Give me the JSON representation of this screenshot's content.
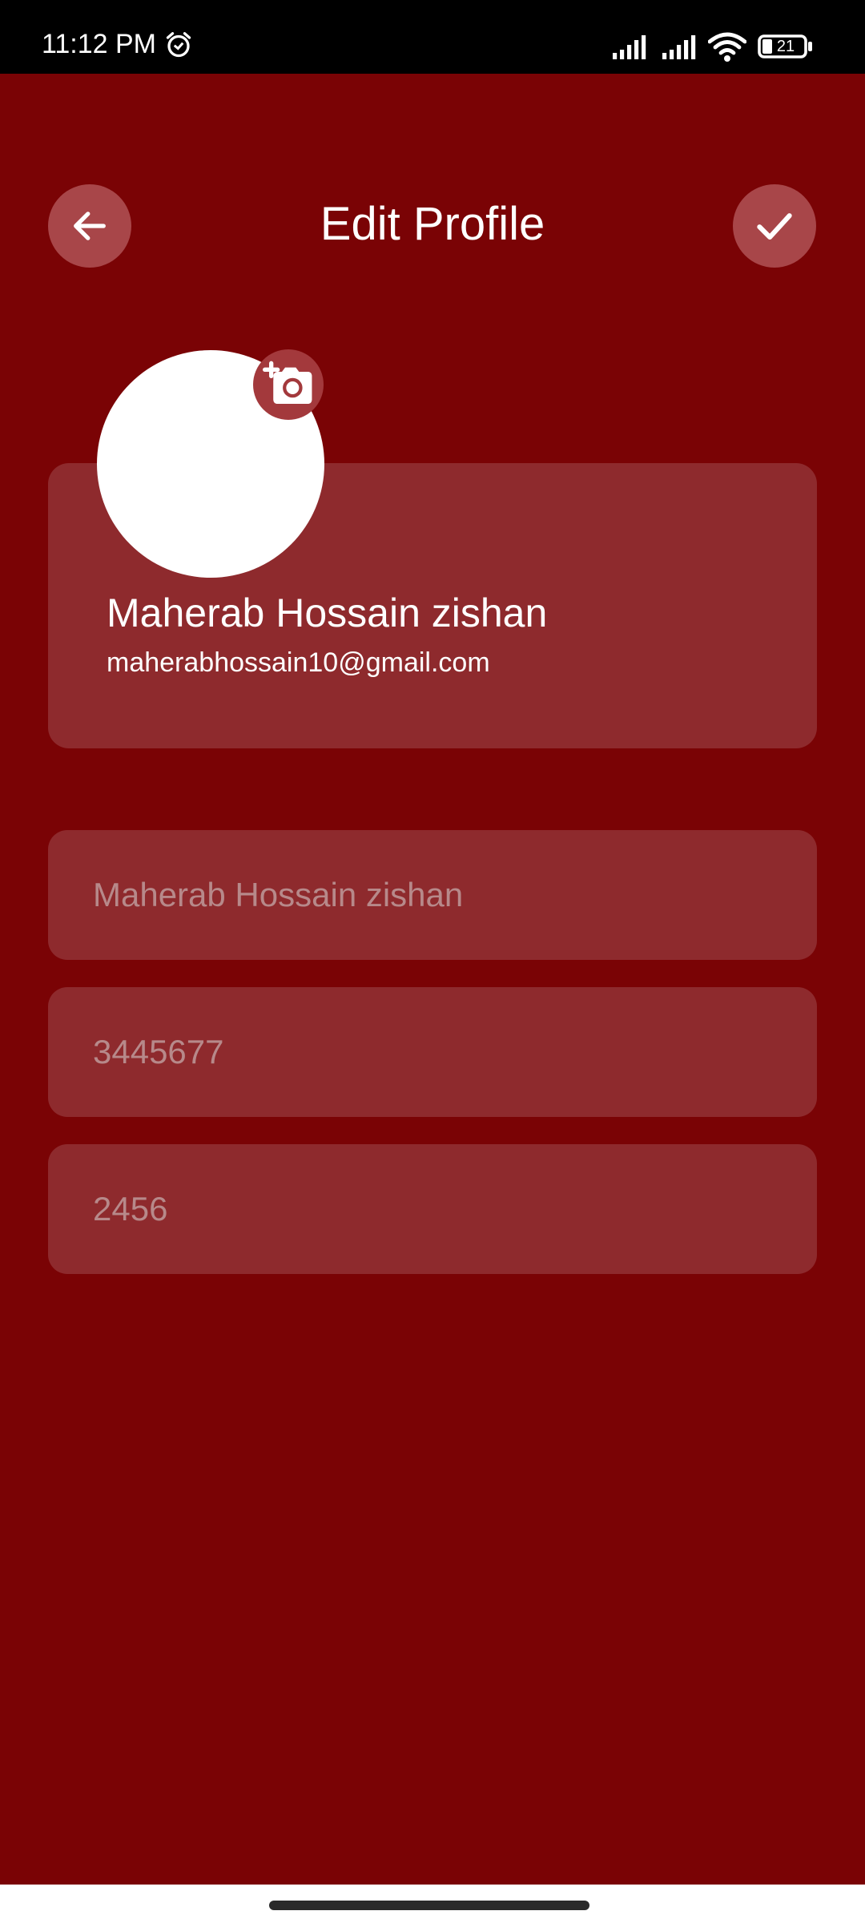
{
  "status_bar": {
    "time": "11:12 PM",
    "battery": "21",
    "icons": [
      "alarm-icon",
      "signal-icon",
      "signal-icon",
      "wifi-icon",
      "battery-icon"
    ]
  },
  "header": {
    "title": "Edit Profile",
    "back_icon": "arrow-left-icon",
    "confirm_icon": "check-icon"
  },
  "profile": {
    "name": "Maherab Hossain zishan",
    "email": "maherabhossain10@gmail.com",
    "camera_icon": "add-photo-camera-icon"
  },
  "form": {
    "name_placeholder": "Maherab Hossain zishan",
    "phone_placeholder": "3445677",
    "code_placeholder": "2456"
  },
  "colors": {
    "background": "#7a0305",
    "card": "#8e2a2d",
    "button": "#a84649",
    "placeholder": "#b7898a"
  }
}
